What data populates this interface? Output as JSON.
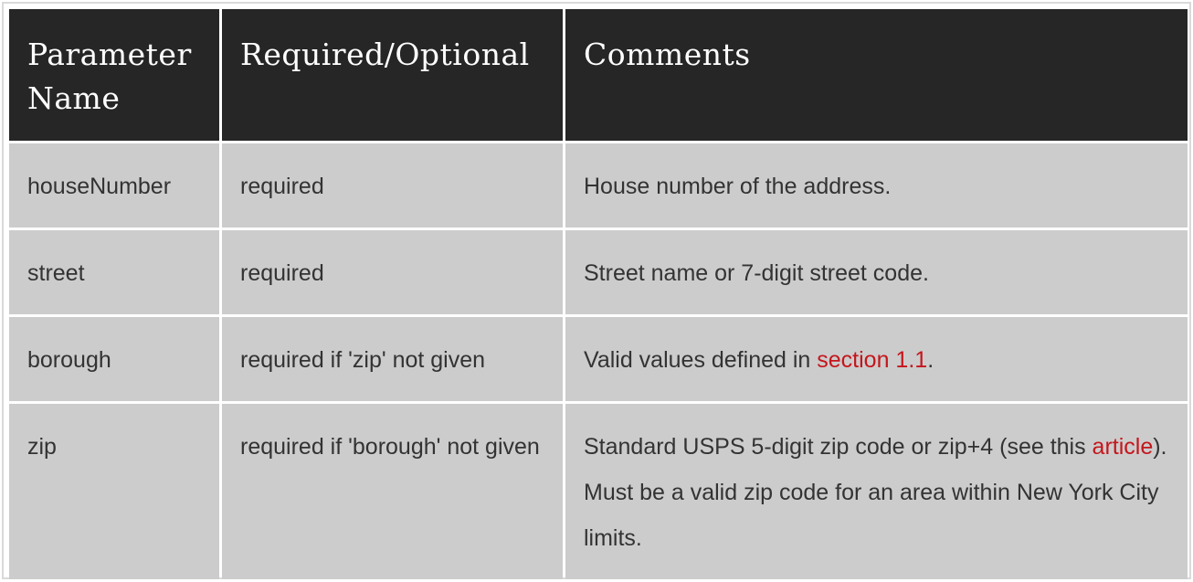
{
  "table": {
    "headers": [
      "Parameter Name",
      "Required/Optional",
      "Comments"
    ],
    "header_lines": {
      "param": [
        "Parameter",
        "Name"
      ],
      "required": "Required/Optional",
      "comments": "Comments"
    },
    "rows": [
      {
        "param": "houseNumber",
        "required": "required",
        "comments": "House number of the address."
      },
      {
        "param": "street",
        "required": "required",
        "comments": "Street name or 7-digit street code."
      },
      {
        "param": "borough",
        "required": "required if 'zip' not given",
        "comments_prefix": "Valid values defined in ",
        "comments_link": "section 1.1",
        "comments_suffix": "."
      },
      {
        "param": "zip",
        "required": "required if 'borough' not given",
        "comments_prefix": "Standard USPS 5-digit zip code or zip+4 (see this ",
        "comments_link": "article",
        "comments_suffix": "). Must be a valid zip code for an area within New York City limits."
      }
    ]
  },
  "colors": {
    "header_bg": "#262626",
    "cell_bg": "#cccccc",
    "link": "#c4161c"
  }
}
